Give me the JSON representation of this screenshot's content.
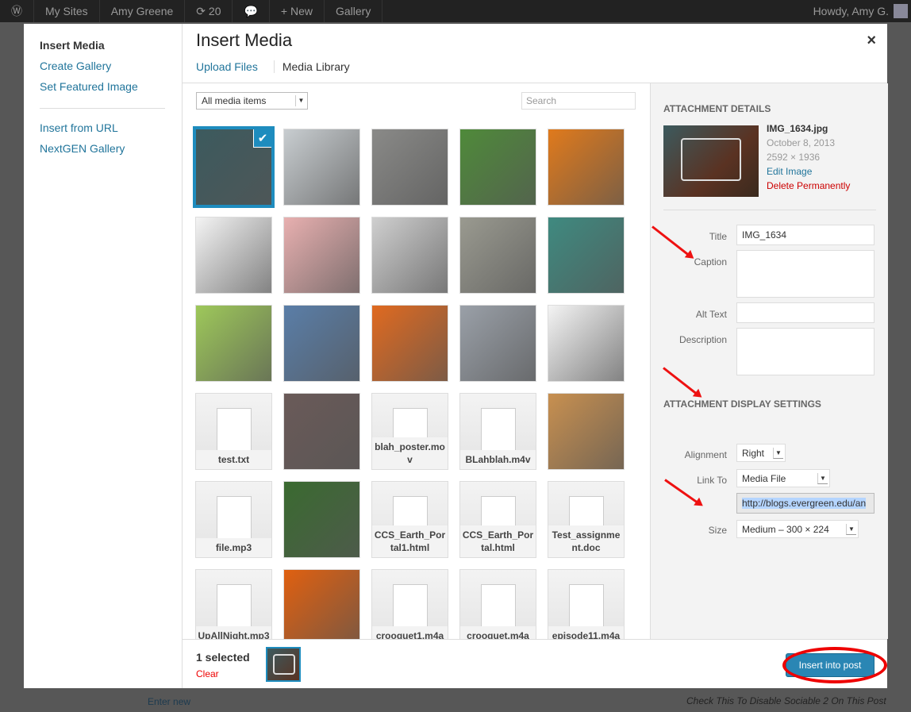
{
  "adminbar": {
    "items": [
      "My Sites",
      "Amy Greene",
      "⟳ 20",
      "💬",
      "+ New",
      "Gallery"
    ],
    "howdy": "Howdy, Amy G."
  },
  "background": {
    "enter_new": "Enter new",
    "sociable": "Check This To Disable Sociable 2 On This Post"
  },
  "menu": {
    "items": [
      "Insert Media",
      "Create Gallery",
      "Set Featured Image",
      "Insert from URL",
      "NextGEN Gallery"
    ]
  },
  "modal": {
    "title": "Insert Media",
    "close": "×",
    "tabs": [
      "Upload Files",
      "Media Library"
    ]
  },
  "browser": {
    "filter": "All media items",
    "search_placeholder": "Search",
    "tiles": [
      {
        "kind": "image",
        "color": "#3c5a5e",
        "selected": true
      },
      {
        "kind": "image",
        "color": "#c8cdd0"
      },
      {
        "kind": "image",
        "color": "#8a8a88"
      },
      {
        "kind": "image",
        "color": "#4f8a3a"
      },
      {
        "kind": "image",
        "color": "#e07a1c"
      },
      {
        "kind": "image",
        "color": "#f4f4f4"
      },
      {
        "kind": "image",
        "color": "#e8b0b0"
      },
      {
        "kind": "image",
        "color": "#cfcfcf"
      },
      {
        "kind": "image",
        "color": "#9a9a90"
      },
      {
        "kind": "image",
        "color": "#3f8a80"
      },
      {
        "kind": "image",
        "color": "#9ec85a"
      },
      {
        "kind": "image",
        "color": "#5a7ea8"
      },
      {
        "kind": "image",
        "color": "#e06a20"
      },
      {
        "kind": "image",
        "color": "#9aa0a8"
      },
      {
        "kind": "image",
        "color": "#f4f4f4"
      },
      {
        "kind": "file",
        "label": "test.txt"
      },
      {
        "kind": "image",
        "color": "#6a5a58"
      },
      {
        "kind": "file",
        "label": "blah_poster.mov"
      },
      {
        "kind": "file",
        "label": "BLahblah.m4v"
      },
      {
        "kind": "image",
        "color": "#c89050"
      },
      {
        "kind": "file",
        "label": "file.mp3"
      },
      {
        "kind": "image",
        "color": "#3a6a30"
      },
      {
        "kind": "file",
        "label": "CCS_Earth_Portal1.html"
      },
      {
        "kind": "file",
        "label": "CCS_Earth_Portal.html"
      },
      {
        "kind": "file",
        "label": "Test_assignment.doc"
      },
      {
        "kind": "file",
        "label": "UpAllNight.mp3"
      },
      {
        "kind": "image",
        "color": "#e06010"
      },
      {
        "kind": "file",
        "label": "crooquet1.m4a"
      },
      {
        "kind": "file",
        "label": "crooquet.m4a"
      },
      {
        "kind": "file",
        "label": "episode11.m4a"
      }
    ]
  },
  "details": {
    "heading": "Attachment Details",
    "filename": "IMG_1634.jpg",
    "date": "October 8, 2013",
    "dimensions": "2592 × 1936",
    "edit": "Edit Image",
    "delete": "Delete Permanently",
    "title_label": "Title",
    "title_value": "IMG_1634",
    "caption_label": "Caption",
    "alt_label": "Alt Text",
    "description_label": "Description"
  },
  "display": {
    "heading": "Attachment Display Settings",
    "alignment_label": "Alignment",
    "alignment": "Right",
    "link_label": "Link To",
    "link": "Media File",
    "url": "http://blogs.evergreen.edu/an",
    "size_label": "Size",
    "size": "Medium – 300 × 224"
  },
  "toolbar": {
    "selected": "1 selected",
    "clear": "Clear",
    "insert": "Insert into post"
  }
}
